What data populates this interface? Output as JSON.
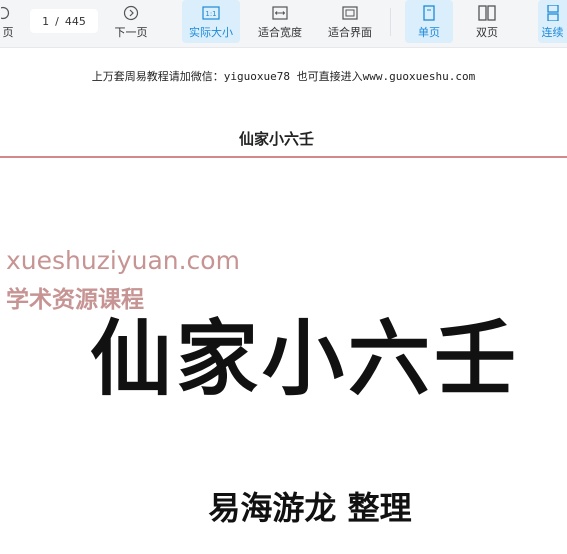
{
  "toolbar": {
    "prev_label_partial": "页",
    "current_page": "1",
    "page_separator": "/",
    "total_pages": "445",
    "next_page": "下一页",
    "actual_size": "实际大小",
    "actual_size_icon_text": "1:1",
    "fit_width": "适合宽度",
    "fit_page": "适合界面",
    "single_page": "单页",
    "double_page": "双页",
    "continuous_partial": "连续",
    "accent_color": "#1c8ad8"
  },
  "document": {
    "notice": "上万套周易教程请加微信：yiguoxue78  也可直接进入www.guoxueshu.com",
    "header_title": "仙家小六壬",
    "watermark_domain": "xueshuziyuan.com",
    "watermark_text": "学术资源课程",
    "book_title": "仙家小六壬",
    "compiler": "易海游龙 整理"
  }
}
